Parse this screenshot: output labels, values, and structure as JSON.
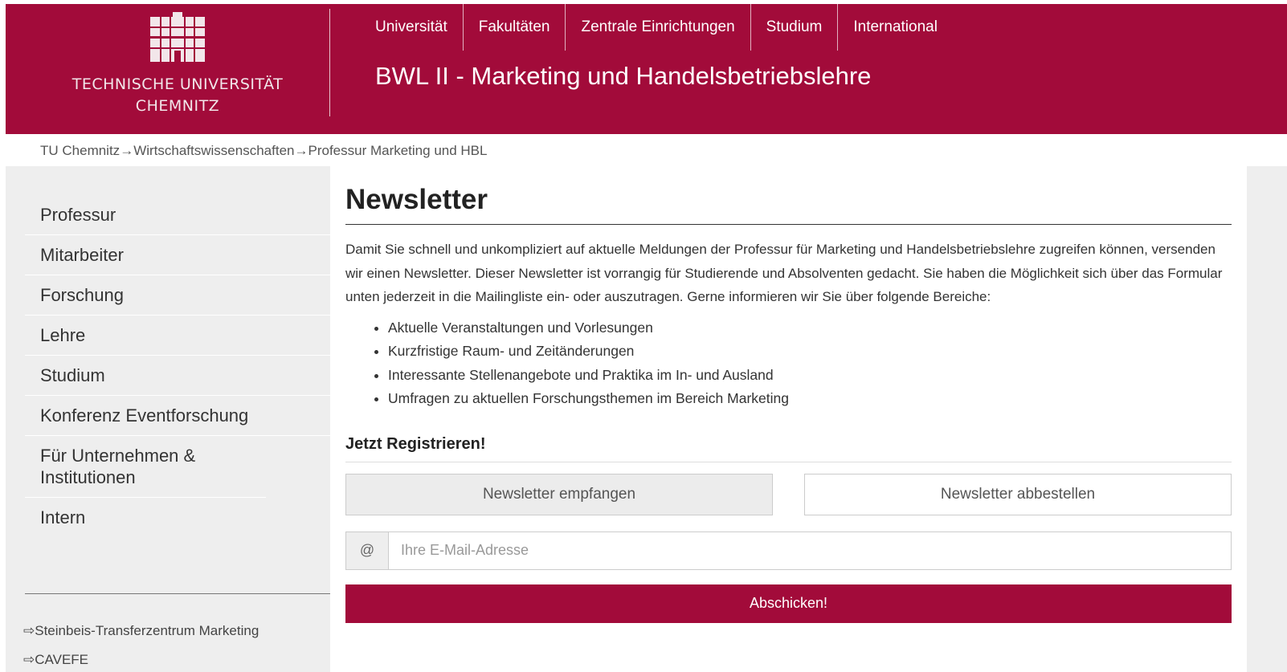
{
  "header": {
    "logo_line1": "TECHNISCHE UNIVERSITÄT",
    "logo_line2": "CHEMNITZ",
    "site_title": "BWL II - Marketing und Handelsbetriebslehre",
    "nav": [
      {
        "label": "Universität"
      },
      {
        "label": "Fakultäten"
      },
      {
        "label": "Zentrale Einrichtungen"
      },
      {
        "label": "Studium"
      },
      {
        "label": "International"
      }
    ],
    "brand_color": "#a20b3a"
  },
  "breadcrumb": {
    "items": [
      "TU Chemnitz",
      "Wirtschaftswissenschaften",
      "Professur Marketing und HBL"
    ],
    "separator": "→"
  },
  "sidebar": {
    "items": [
      {
        "label": "Professur"
      },
      {
        "label": "Mitarbeiter"
      },
      {
        "label": "Forschung"
      },
      {
        "label": "Lehre"
      },
      {
        "label": "Studium"
      },
      {
        "label": "Konferenz Eventforschung"
      },
      {
        "label": "Für Unternehmen & Institutionen"
      },
      {
        "label": "Intern"
      }
    ],
    "external_link_icon": "⇨",
    "external_link": "Steinbeis-Transferzentrum Marketing",
    "cutoff_icon": "⇨",
    "cutoff_link": "CAVEFE"
  },
  "main": {
    "title": "Newsletter",
    "intro": "Damit Sie schnell und unkompliziert auf aktuelle Meldungen der Professur für Marketing und Handelsbetriebslehre zugreifen können, versenden wir einen Newsletter. Dieser Newsletter ist vorrangig für Studierende und Absolventen gedacht. Sie haben die Möglichkeit sich über das Formular unten jederzeit in die Mailingliste ein- oder auszutragen. Gerne informieren wir Sie über folgende Bereiche:",
    "features": [
      "Aktuelle Veranstaltungen und Vorlesungen",
      "Kurzfristige Raum- und Zeitänderungen",
      "Interessante Stellenangebote und Praktika im In- und Ausland",
      "Umfragen zu aktuellen Forschungsthemen im Bereich Marketing"
    ],
    "register_heading": "Jetzt Registrieren!",
    "subscribe_label": "Newsletter empfangen",
    "unsubscribe_label": "Newsletter abbestellen",
    "email_addon": "@",
    "email_placeholder": "Ihre E-Mail-Adresse",
    "email_value": "",
    "submit_label": "Abschicken!"
  }
}
